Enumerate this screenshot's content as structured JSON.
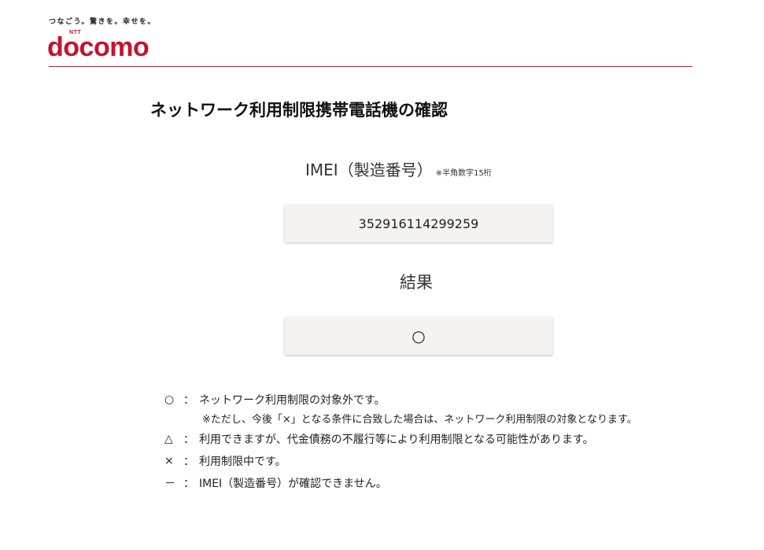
{
  "header": {
    "tagline": "つなごう。驚きを。幸せを。",
    "logo_ntt": "NTT",
    "logo_text": "docomo",
    "brand_color": "#c8102e"
  },
  "page": {
    "title": "ネットワーク利用制限携帯電話機の確認"
  },
  "imei": {
    "label": "IMEI（製造番号）",
    "note": "※半角数字15桁",
    "value": "352916114299259"
  },
  "result": {
    "label": "結果",
    "value": "○"
  },
  "legend": [
    {
      "symbol": "○",
      "colon": "：",
      "text": "ネットワーク利用制限の対象外です。",
      "note": "※ただし、今後「×」となる条件に合致した場合は、ネットワーク利用制限の対象となります。"
    },
    {
      "symbol": "△",
      "colon": "：",
      "text": "利用できますが、代金債務の不履行等により利用制限となる可能性があります。"
    },
    {
      "symbol": "×",
      "colon": "：",
      "text": "利用制限中です。"
    },
    {
      "symbol": "－",
      "colon": "：",
      "text": "IMEI（製造番号）が確認できません。"
    }
  ]
}
